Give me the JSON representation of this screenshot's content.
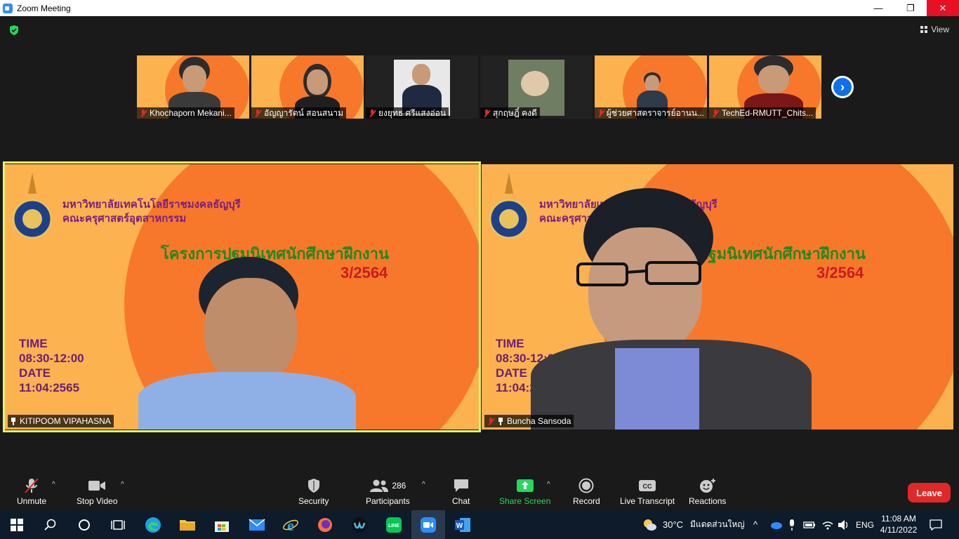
{
  "window": {
    "title": "Zoom Meeting",
    "minimize": "—",
    "maximize": "❐",
    "close": "✕"
  },
  "top": {
    "view_label": "View"
  },
  "thumbnails": [
    {
      "name": "Khochaporn Mekani..."
    },
    {
      "name": "อัญญารัตน์ สอนสนาม"
    },
    {
      "name": "ยงยุทธ ศรีแสงอ่อน"
    },
    {
      "name": "สุกฤษฎิ์ คงดี"
    },
    {
      "name": "ผู้ช่วยศาสตราจารย์อานน..."
    },
    {
      "name": "TechEd-RMUTT_Chits..."
    }
  ],
  "slide": {
    "university": "มหาวิทยาลัยเทคโนโลยีราชมงคลธัญบุรี",
    "faculty": "คณะครุศาสตร์อุตสาหกรรม",
    "project": "โครงการปฐมนิเทศนักศึกษาฝึกงาน",
    "term": "3/2564",
    "time_label": "TIME",
    "time_value": "08:30-12:00",
    "date_label": "DATE",
    "date_value": "11:04:2565"
  },
  "tiles": [
    {
      "name": "KITIPOOM VIPAHASNA"
    },
    {
      "name": "Buncha Sansoda"
    }
  ],
  "toolbar": {
    "unmute": "Unmute",
    "stop_video": "Stop Video",
    "security": "Security",
    "participants": "Participants",
    "participants_count": "286",
    "chat": "Chat",
    "share_screen": "Share Screen",
    "record": "Record",
    "live_transcript": "Live Transcript",
    "reactions": "Reactions",
    "leave": "Leave",
    "share_color": "#23d959"
  },
  "taskbar": {
    "weather_temp": "30°C",
    "weather_text": "มีแดดส่วนใหญ่",
    "language": "ENG",
    "time": "11:08 AM",
    "date": "4/11/2022"
  }
}
